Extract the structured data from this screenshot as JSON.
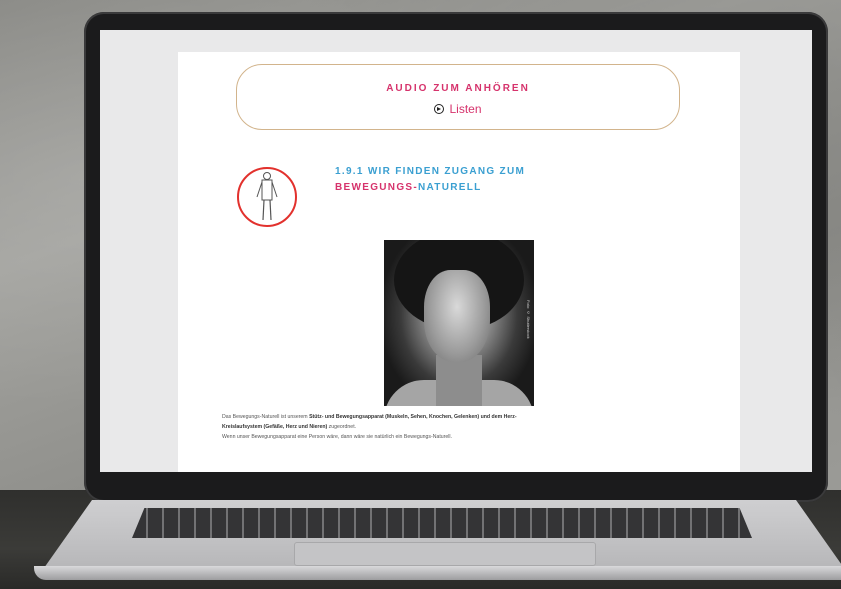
{
  "audio": {
    "title": "AUDIO ZUM ANHÖREN",
    "link_label": "Listen",
    "link_icon": "circle-arrow-icon"
  },
  "section": {
    "number_title": "1.9.1 WIR FINDEN ZUGANG ZUM",
    "subtitle_part1": "BEWEGUNGS-",
    "subtitle_part2": "NATURELL",
    "icon": "human-figure-icon"
  },
  "photo": {
    "credit": "Foto: © Shutterstock"
  },
  "body": {
    "line1_plain": "Das Bewegungs-Naturell ist unserem ",
    "line1_bold": "Stütz- und Bewegungsapparat (Muskeln, Sehen, Knochen, Gelenken) und dem Herz-",
    "line2_bold": "Kreislaufsystem (Gefäße, Herz und Nieren)",
    "line2_plain": " zugeordnet.",
    "line3": "Wenn unser Bewegungsapparat eine Person wäre, dann wäre sie natürlich ein Bewegungs-Naturell."
  },
  "colors": {
    "accent_pink": "#d6336c",
    "accent_blue": "#3a9fd1",
    "box_border": "#d2b48c",
    "icon_circle": "#e2312d"
  }
}
